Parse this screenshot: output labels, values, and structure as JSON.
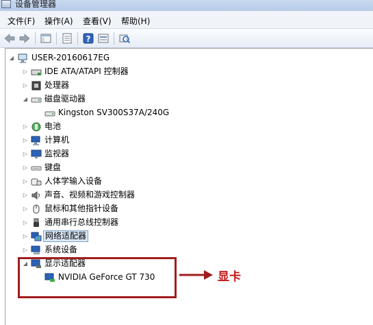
{
  "window": {
    "title": "设备管理器"
  },
  "menu": [
    {
      "label": "文件(F)"
    },
    {
      "label": "操作(A)"
    },
    {
      "label": "查看(V)"
    },
    {
      "label": "帮助(H)"
    }
  ],
  "toolbar": {
    "buttons": [
      "back-icon",
      "forward-icon",
      "console-tree-icon",
      "properties-icon",
      "help-icon",
      "view-icon",
      "scan-hardware-icon"
    ]
  },
  "tree": {
    "root": "USER-20160617EG",
    "items": [
      {
        "label": "IDE ATA/ATAPI 控制器",
        "icon": "ide-controller-icon",
        "state": "collapsed"
      },
      {
        "label": "处理器",
        "icon": "processor-icon",
        "state": "collapsed"
      },
      {
        "label": "磁盘驱动器",
        "icon": "disk-drive-icon",
        "state": "expanded"
      },
      {
        "label": "Kingston SV300S37A/240G",
        "icon": "disk-icon",
        "state": "leaf"
      },
      {
        "label": "电池",
        "icon": "battery-icon",
        "state": "collapsed"
      },
      {
        "label": "计算机",
        "icon": "computer-icon",
        "state": "collapsed"
      },
      {
        "label": "监视器",
        "icon": "monitor-icon",
        "state": "collapsed"
      },
      {
        "label": "键盘",
        "icon": "keyboard-icon",
        "state": "collapsed"
      },
      {
        "label": "人体学输入设备",
        "icon": "hid-icon",
        "state": "collapsed"
      },
      {
        "label": "声音、视频和游戏控制器",
        "icon": "sound-icon",
        "state": "collapsed"
      },
      {
        "label": "鼠标和其他指针设备",
        "icon": "mouse-icon",
        "state": "collapsed"
      },
      {
        "label": "通用串行总线控制器",
        "icon": "usb-icon",
        "state": "collapsed"
      },
      {
        "label": "网络适配器",
        "icon": "network-icon",
        "state": "collapsed"
      },
      {
        "label": "系统设备",
        "icon": "system-icon",
        "state": "collapsed"
      },
      {
        "label": "显示适配器",
        "icon": "display-adapter-icon",
        "state": "expanded"
      },
      {
        "label": "NVIDIA GeForce GT 730",
        "icon": "gpu-icon",
        "state": "leaf"
      }
    ]
  },
  "annotation": {
    "label": "显卡",
    "color": "#c01818"
  }
}
